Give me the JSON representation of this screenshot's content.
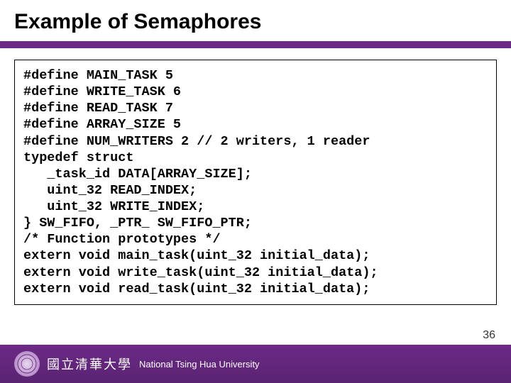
{
  "title": "Example of Semaphores",
  "code": "#define MAIN_TASK 5\n#define WRITE_TASK 6\n#define READ_TASK 7\n#define ARRAY_SIZE 5\n#define NUM_WRITERS 2 // 2 writers, 1 reader\ntypedef struct\n   _task_id DATA[ARRAY_SIZE];\n   uint_32 READ_INDEX;\n   uint_32 WRITE_INDEX;\n} SW_FIFO, _PTR_ SW_FIFO_PTR;\n/* Function prototypes */\nextern void main_task(uint_32 initial_data);\nextern void write_task(uint_32 initial_data);\nextern void read_task(uint_32 initial_data);",
  "footer": {
    "university_cn": "國立清華大學",
    "university_en": "National Tsing Hua University"
  },
  "page_number": "36"
}
